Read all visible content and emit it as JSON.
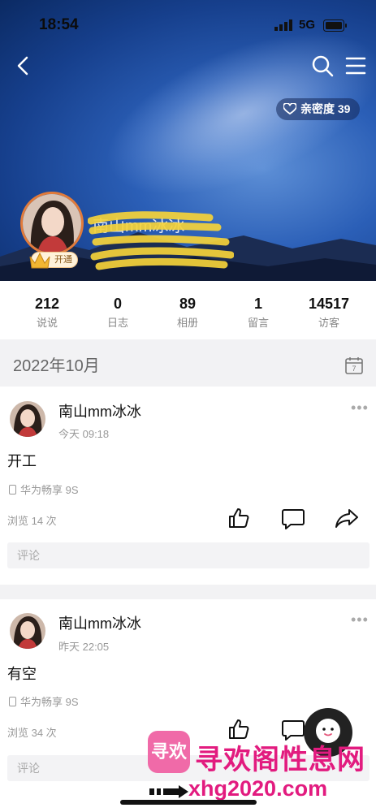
{
  "status": {
    "time": "18:54",
    "network": "5G"
  },
  "header": {
    "intimacy_label": "亲密度",
    "intimacy_value": "39",
    "vip_label": "开通",
    "profile_name": "南山mm冰冰",
    "icons": [
      "back-icon",
      "search-icon",
      "menu-icon",
      "heart-icon",
      "crown-icon"
    ]
  },
  "stats": [
    {
      "value": "212",
      "label": "说说"
    },
    {
      "value": "0",
      "label": "日志"
    },
    {
      "value": "89",
      "label": "相册"
    },
    {
      "value": "1",
      "label": "留言"
    },
    {
      "value": "14517",
      "label": "访客"
    }
  ],
  "month": {
    "title": "2022年10月",
    "calendar_day": "7"
  },
  "posts": [
    {
      "author": "南山mm冰冰",
      "time": "今天 09:18",
      "text": "开工",
      "device": "华为畅享 9S",
      "views": "浏览 14 次",
      "comment_placeholder": "评论"
    },
    {
      "author": "南山mm冰冰",
      "time": "昨天 22:05",
      "text": "有空",
      "device": "华为畅享 9S",
      "views": "浏览 34 次",
      "comment_placeholder": "评论"
    }
  ],
  "watermark": {
    "logo": "寻欢",
    "title": "寻欢阁性息网",
    "url": "xhg2020.com"
  },
  "colors": {
    "accent_pink": "#e21b7f",
    "sky_blue": "#2b5fb7",
    "avatar_ring": "#e27b3a"
  }
}
